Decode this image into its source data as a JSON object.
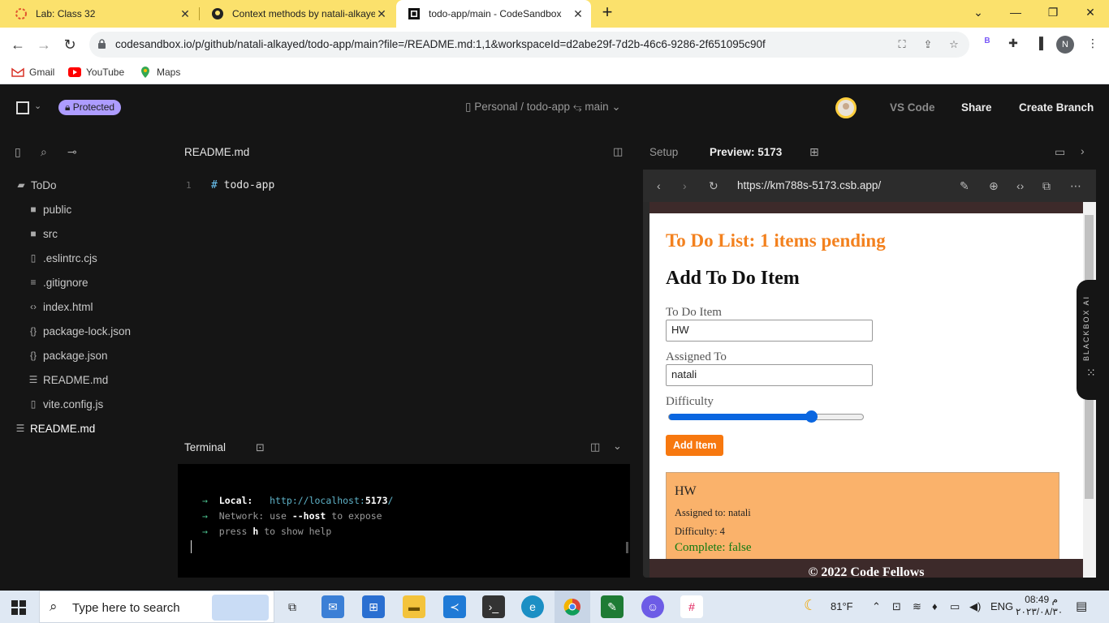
{
  "browser": {
    "tabs": [
      {
        "title": "Lab: Class 32",
        "icon": "codefellows-icon",
        "active": false
      },
      {
        "title": "Context methods by natali-alkaye",
        "icon": "github-icon",
        "active": false
      },
      {
        "title": "todo-app/main - CodeSandbox",
        "icon": "codesandbox-icon",
        "active": true
      }
    ],
    "url": "codesandbox.io/p/github/natali-alkayed/todo-app/main?file=/README.md:1,1&workspaceId=d2abe29f-7d2b-46c6-9286-2f651095c90f",
    "profile_initial": "N",
    "extension_badge": "B",
    "bookmarks": [
      "Gmail",
      "YouTube",
      "Maps"
    ]
  },
  "codesandbox": {
    "protected_label": "Protected",
    "breadcrumb": "Personal / todo-app",
    "branch": "main",
    "buttons": {
      "vscode": "VS Code",
      "share": "Share",
      "create_branch": "Create Branch"
    },
    "explorer": {
      "root": "ToDo",
      "items": [
        {
          "name": "public",
          "icon": "folder-icon"
        },
        {
          "name": "src",
          "icon": "folder-icon"
        },
        {
          "name": ".eslintrc.cjs",
          "icon": "file-icon"
        },
        {
          "name": ".gitignore",
          "icon": "lines-icon"
        },
        {
          "name": "index.html",
          "icon": "code-icon"
        },
        {
          "name": "package-lock.json",
          "icon": "braces-icon"
        },
        {
          "name": "package.json",
          "icon": "braces-icon"
        },
        {
          "name": "README.md",
          "icon": "markdown-icon"
        },
        {
          "name": "vite.config.js",
          "icon": "file-icon"
        }
      ],
      "open_file": "README.md"
    },
    "editor": {
      "filename": "README.md",
      "line_number": "1",
      "code_hash": "#",
      "code_text": " todo-app"
    },
    "terminal": {
      "title": "Terminal",
      "lines": {
        "local_label": "Local:",
        "local_url_prefix": "http://localhost:",
        "local_port": "5173",
        "local_url_suffix": "/",
        "network_label": "Network:",
        "network_pre": " use ",
        "network_flag": "--host",
        "network_post": " to expose",
        "help_pre": "press ",
        "help_key": "h",
        "help_post": " to show help"
      }
    },
    "preview": {
      "setup_tab": "Setup",
      "preview_tab": "Preview: 5173",
      "url": "https://km788s-5173.csb.app/"
    }
  },
  "app": {
    "heading": "To Do List: 1 items pending",
    "form_title": "Add To Do Item",
    "todo_label": "To Do Item",
    "todo_value": "HW",
    "assigned_label": "Assigned To",
    "assigned_value": "natali",
    "difficulty_label": "Difficulty",
    "difficulty_fraction": 0.73,
    "add_button": "Add Item",
    "card": {
      "title": "HW",
      "assigned": "Assigned to: natali",
      "difficulty": "Difficulty: 4",
      "complete": "Complete: false"
    },
    "footer": "© 2022 Code Fellows"
  },
  "blackbox_label": "BLACKBOX AI",
  "taskbar": {
    "search_placeholder": "Type here to search",
    "weather": "81°F",
    "language": "ENG",
    "time": "08:49 م",
    "date": "٢٠٢٣/٠٨/٣٠"
  }
}
